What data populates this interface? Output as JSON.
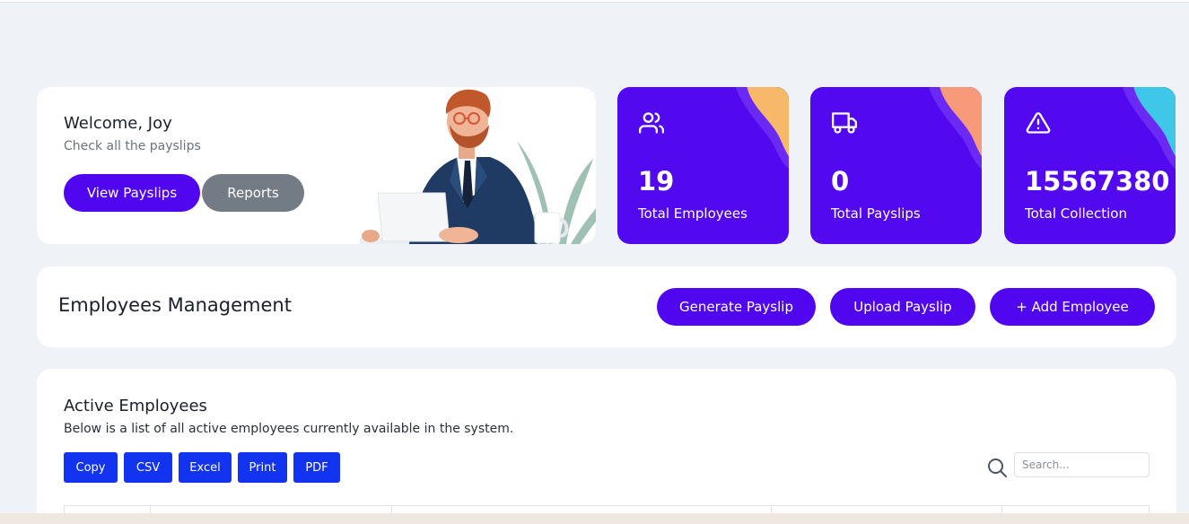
{
  "welcome": {
    "title": "Welcome, Joy",
    "subtitle": "Check all the payslips",
    "view_payslips_label": "View Payslips",
    "reports_label": "Reports"
  },
  "stats": [
    {
      "value": "19",
      "label": "Total Employees",
      "icon": "users-icon",
      "accent": "#f7b86a"
    },
    {
      "value": "0",
      "label": "Total Payslips",
      "icon": "truck-icon",
      "accent": "#f79a7a"
    },
    {
      "value": "15567380",
      "label": "Total Collection",
      "icon": "alert-triangle-icon",
      "accent": "#3fc7ea"
    }
  ],
  "management": {
    "title": "Employees Management",
    "generate_label": "Generate Payslip",
    "upload_label": "Upload Payslip",
    "add_label": "+ Add Employee"
  },
  "active": {
    "title": "Active Employees",
    "description": "Below is a list of all active employees currently available in the system.",
    "export_buttons": [
      "Copy",
      "CSV",
      "Excel",
      "Print",
      "PDF"
    ],
    "search_placeholder": "Search..."
  },
  "colors": {
    "primary": "#5007f0",
    "secondary": "#737c85",
    "export": "#1233f0",
    "background": "#eff3f8"
  }
}
